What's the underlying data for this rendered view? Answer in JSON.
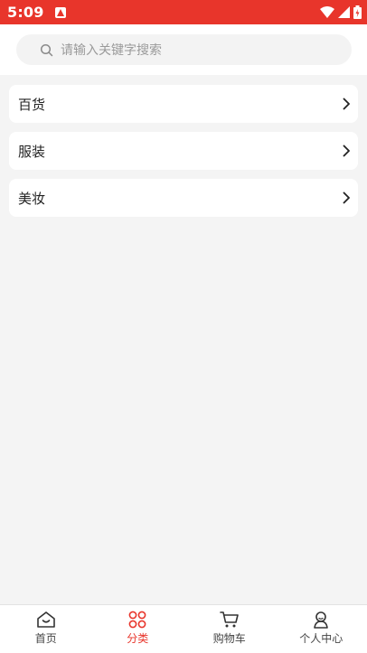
{
  "status_bar": {
    "time": "5:09",
    "background": "#e8352b"
  },
  "search": {
    "placeholder": "请输入关键字搜索",
    "icon": "search-icon"
  },
  "categories": [
    {
      "label": "百货",
      "icon": "chevron-right-icon"
    },
    {
      "label": "服装",
      "icon": "chevron-right-icon"
    },
    {
      "label": "美妆",
      "icon": "chevron-right-icon"
    }
  ],
  "tab_bar": {
    "active_color": "#e8352b",
    "tabs": [
      {
        "label": "首页",
        "icon": "home-icon",
        "active": false
      },
      {
        "label": "分类",
        "icon": "category-grid-icon",
        "active": true
      },
      {
        "label": "购物车",
        "icon": "cart-icon",
        "active": false
      },
      {
        "label": "个人中心",
        "icon": "profile-icon",
        "active": false
      }
    ]
  }
}
